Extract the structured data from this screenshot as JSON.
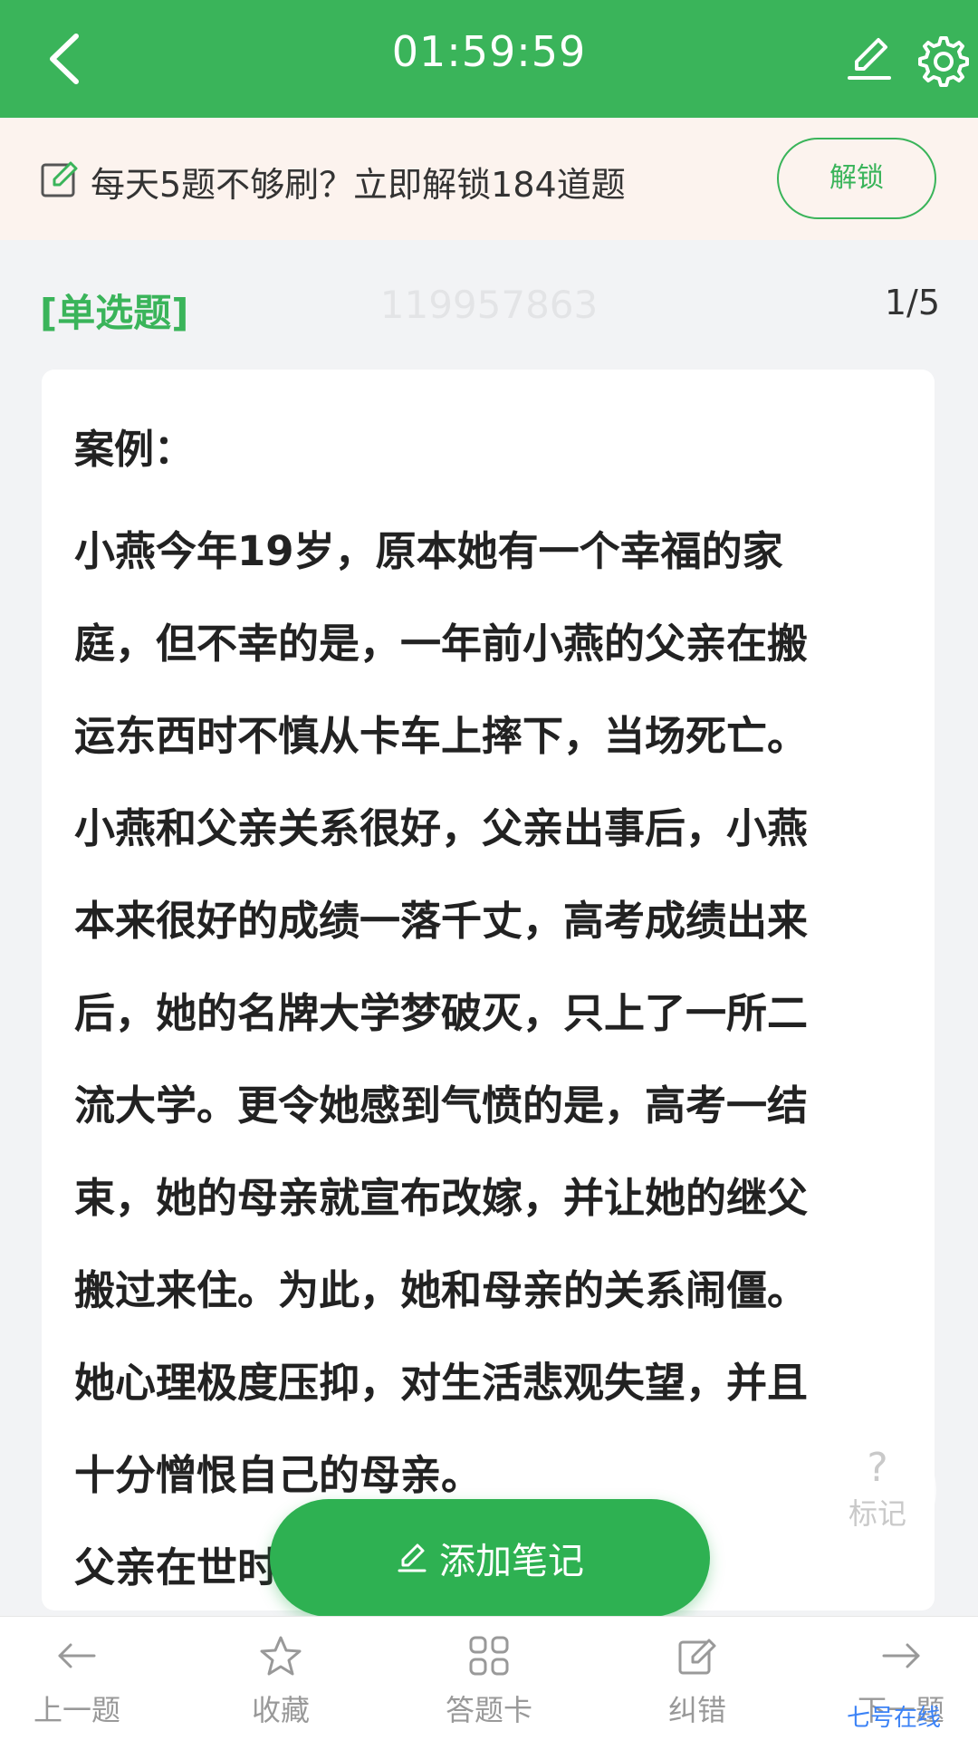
{
  "header": {
    "timer": "01:59:59",
    "icons": [
      "back-arrow-icon",
      "edit-pen-icon",
      "settings-gear-icon"
    ],
    "background": "#3ab45a"
  },
  "banner": {
    "text": "每天5题不够刷？立即解锁184道题",
    "unlock_label": "解锁"
  },
  "question": {
    "type_label": "[单选题]",
    "id": "119957863",
    "pager": "1/5",
    "case_label": "案例：",
    "lines": [
      "小燕今年19岁，原本她有一个幸福的家",
      "庭，但不幸的是，一年前小燕的父亲在搬",
      "运东西时不慎从卡车上摔下，当场死亡。",
      "小燕和父亲关系很好，父亲出事后，小燕",
      "本来很好的成绩一落千丈，高考成绩出来",
      "后，她的名牌大学梦破灭，只上了一所二",
      "流大学。更令她感到气愤的是，高考一结",
      "束，她的母亲就宣布改嫁，并让她的继父",
      "搬过来住。为此，她和母亲的关系闹僵。",
      "她心理极度压抑，对生活悲观失望，并且",
      "十分憎恨自己的母亲。",
      "父亲在世时，小燕和父母一家人住"
    ]
  },
  "float_mark": {
    "symbol": "?",
    "label": "标记"
  },
  "add_note": {
    "label": "添加笔记"
  },
  "bottom_nav": [
    {
      "label": "上一题",
      "icon": "arrow-left-icon"
    },
    {
      "label": "收藏",
      "icon": "star-icon"
    },
    {
      "label": "答题卡",
      "icon": "grid-icon"
    },
    {
      "label": "纠错",
      "icon": "edit-icon"
    },
    {
      "label": "下一题",
      "icon": "arrow-right-icon"
    }
  ],
  "watermark": "七号在线"
}
